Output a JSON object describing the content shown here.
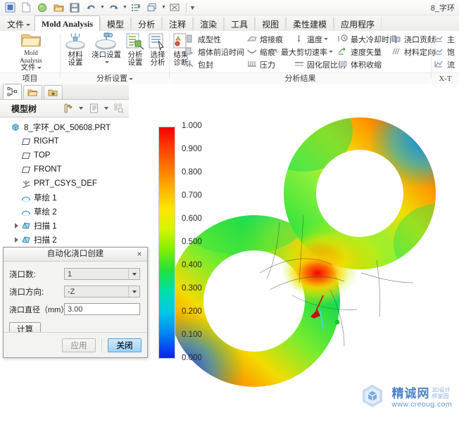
{
  "window": {
    "document_title": "8_字环"
  },
  "quick_access": {
    "items": [
      {
        "name": "app-window-icon",
        "glyph": "window"
      },
      {
        "name": "new-file-icon",
        "glyph": "new"
      },
      {
        "name": "open-model-icon",
        "glyph": "sphere"
      },
      {
        "name": "open-folder-icon",
        "glyph": "folder"
      },
      {
        "name": "save-icon",
        "glyph": "save"
      },
      {
        "name": "undo-icon",
        "glyph": "undo"
      },
      {
        "name": "redo-icon",
        "glyph": "redo"
      },
      {
        "name": "regenerate-icon",
        "glyph": "regen"
      },
      {
        "name": "window-manager-icon",
        "glyph": "windows"
      },
      {
        "name": "close-window-icon",
        "glyph": "closewin"
      }
    ]
  },
  "ribbon": {
    "tabs": [
      {
        "label": "文件",
        "name": "tab-file",
        "active": false,
        "dropdown": true
      },
      {
        "label": "Mold Analysis",
        "name": "tab-mold-analysis",
        "active": true
      },
      {
        "label": "模型",
        "name": "tab-model",
        "active": false
      },
      {
        "label": "分析",
        "name": "tab-analysis",
        "active": false
      },
      {
        "label": "注释",
        "name": "tab-annotation",
        "active": false
      },
      {
        "label": "渲染",
        "name": "tab-render",
        "active": false
      },
      {
        "label": "工具",
        "name": "tab-tools",
        "active": false
      },
      {
        "label": "视图",
        "name": "tab-view",
        "active": false
      },
      {
        "label": "柔性建模",
        "name": "tab-flexible-modeling",
        "active": false
      },
      {
        "label": "应用程序",
        "name": "tab-applications",
        "active": false
      }
    ],
    "groups": [
      {
        "title": "项目",
        "name": "ribbon-group-project",
        "dropdown": false
      },
      {
        "title": "分析设置",
        "name": "ribbon-group-analysis-settings",
        "dropdown": true
      },
      {
        "title": "分析结果",
        "name": "ribbon-group-analysis-results",
        "dropdown": false
      },
      {
        "title": "X-T",
        "name": "ribbon-group-extra",
        "dropdown": false
      }
    ],
    "project_buttons": [
      {
        "line1": "Mold Analysis",
        "line2": "文件",
        "name": "mold-analysis-file-button",
        "dropdown": true
      }
    ],
    "analysis_setting_buttons": [
      {
        "line1": "材料",
        "line2": "设置",
        "name": "material-settings-button",
        "dropdown": false
      },
      {
        "line1": "浇口设置",
        "line2": "",
        "name": "gate-settings-button",
        "dropdown": true
      },
      {
        "line1": "分析",
        "line2": "设置",
        "name": "analysis-settings-button",
        "dropdown": false
      },
      {
        "line1": "选择",
        "line2": "分析",
        "name": "select-analysis-button",
        "dropdown": false
      }
    ],
    "result_diag_buttons": [
      {
        "line1": "结果",
        "line2": "诊断",
        "name": "result-diagnostics-button",
        "dropdown": false
      }
    ],
    "result_items_col1": [
      {
        "label": "成型性",
        "name": "result-moldability",
        "icon": "bar-icon",
        "dropdown": false
      },
      {
        "label": "熔体前沿时间",
        "name": "result-melt-front-time",
        "icon": "flow-icon",
        "dropdown": false
      },
      {
        "label": "包封",
        "name": "result-air-trap",
        "icon": "airtrap-icon",
        "dropdown": false
      }
    ],
    "result_items_col2": [
      {
        "label": "熔接痕",
        "name": "result-weld-line",
        "icon": "weldline-icon",
        "dropdown": false
      },
      {
        "label": "缩痕",
        "name": "result-sink-mark",
        "icon": "sinkmark-icon",
        "dropdown": false
      },
      {
        "label": "压力",
        "name": "result-pressure",
        "icon": "pressure-icon",
        "dropdown": false
      }
    ],
    "result_items_col3": [
      {
        "label": "温度",
        "name": "result-temperature",
        "icon": "temperature-icon",
        "dropdown": true
      },
      {
        "label": "最大剪切速率",
        "name": "result-max-shear-rate",
        "icon": "shearrate-icon",
        "dropdown": true
      },
      {
        "label": "固化层比例",
        "name": "result-frozen-layer",
        "icon": "frozenlayer-icon",
        "dropdown": false
      }
    ],
    "result_items_col4": [
      {
        "label": "最大冷却时间",
        "name": "result-max-cooling-time",
        "icon": "coolingtime-icon",
        "dropdown": false
      },
      {
        "label": "速度矢量",
        "name": "result-velocity-vector",
        "icon": "velocity-icon",
        "dropdown": false
      },
      {
        "label": "体积收缩",
        "name": "result-volume-shrink",
        "icon": "volshrink-icon",
        "dropdown": false
      }
    ],
    "result_items_col5": [
      {
        "label": "浇口贡献",
        "name": "result-gate-contribution",
        "icon": "gatecontrib-icon",
        "dropdown": false
      },
      {
        "label": "材料定向",
        "name": "result-material-orientation",
        "icon": "orientation-icon",
        "dropdown": false
      }
    ],
    "result_items_col6": [
      {
        "label": "主",
        "name": "result-extra-1",
        "icon": "chart-icon",
        "dropdown": false
      },
      {
        "label": "饱",
        "name": "result-extra-2",
        "icon": "chart-icon",
        "dropdown": false
      },
      {
        "label": "流",
        "name": "result-extra-3",
        "icon": "chart-icon",
        "dropdown": false
      }
    ]
  },
  "left_panel": {
    "tabs": [
      {
        "name": "panel-tab-model-tree",
        "icon": "tree-icon",
        "active": true
      },
      {
        "name": "panel-tab-folder-browser",
        "icon": "folders-icon",
        "active": false
      },
      {
        "name": "panel-tab-favorites",
        "icon": "favorites-icon",
        "active": false
      }
    ],
    "tree_title": "模型树",
    "tree_toolbar": [
      {
        "name": "tree-filter-icon",
        "icon": "tools",
        "dropdown": true
      },
      {
        "name": "tree-settings-icon",
        "icon": "list",
        "dropdown": true
      },
      {
        "name": "tree-search-icon",
        "icon": "search",
        "dropdown": false
      }
    ],
    "tree_items": [
      {
        "label": "8_字环_OK_50608.PRT",
        "name": "tree-item-part-root",
        "icon": "part-icon",
        "indent": 0,
        "expandable": false
      },
      {
        "label": "RIGHT",
        "name": "tree-item-right",
        "icon": "plane-icon",
        "indent": 1,
        "expandable": false
      },
      {
        "label": "TOP",
        "name": "tree-item-top",
        "icon": "plane-icon",
        "indent": 1,
        "expandable": false
      },
      {
        "label": "FRONT",
        "name": "tree-item-front",
        "icon": "plane-icon",
        "indent": 1,
        "expandable": false
      },
      {
        "label": "PRT_CSYS_DEF",
        "name": "tree-item-csys",
        "icon": "csys-icon",
        "indent": 1,
        "expandable": false
      },
      {
        "label": "草绘 1",
        "name": "tree-item-sketch-1",
        "icon": "sketch-icon",
        "indent": 1,
        "expandable": false
      },
      {
        "label": "草绘 2",
        "name": "tree-item-sketch-2",
        "icon": "sketch-icon",
        "indent": 1,
        "expandable": false
      },
      {
        "label": "扫描 1",
        "name": "tree-item-sweep-1",
        "icon": "sweep-icon",
        "indent": 1,
        "expandable": true
      },
      {
        "label": "扫描 2",
        "name": "tree-item-sweep-2",
        "icon": "sweep-icon",
        "indent": 1,
        "expandable": true
      }
    ]
  },
  "dialog": {
    "title": "自动化浇口创建",
    "close_label": "×",
    "fields": [
      {
        "label": "浇口数:",
        "name": "gate-count",
        "value": "1",
        "type": "combo"
      },
      {
        "label": "浇口方向:",
        "name": "gate-direction",
        "value": "-Z",
        "type": "combo"
      },
      {
        "label": "浇口直径（mm）:",
        "name": "gate-diameter",
        "value": "3.00",
        "type": "text"
      }
    ],
    "compute_label": "计算",
    "apply_label": "应用",
    "close_button_label": "关闭"
  },
  "watermark": {
    "cn": "精诚网",
    "sub1": "3D设计",
    "sub2": "师家园",
    "url": "www.creoug.com"
  },
  "chart_data": {
    "type": "heatmap",
    "title": "",
    "colorbar_label": "",
    "ticks": [
      "1.000",
      "0.900",
      "0.800",
      "0.700",
      "0.600",
      "0.500",
      "0.400",
      "0.300",
      "0.200",
      "0.100",
      "0.000"
    ],
    "range": [
      0.0,
      1.0
    ],
    "colormap": [
      "#0b20f0",
      "#0088f5",
      "#00c8e8",
      "#00e0a8",
      "#22e23a",
      "#8cf000",
      "#d8f500",
      "#ffe400",
      "#ffb400",
      "#ff7a00",
      "#ff3800",
      "#f50000"
    ],
    "legend_position": "left",
    "model": "figure-eight torus mold-flow result"
  }
}
